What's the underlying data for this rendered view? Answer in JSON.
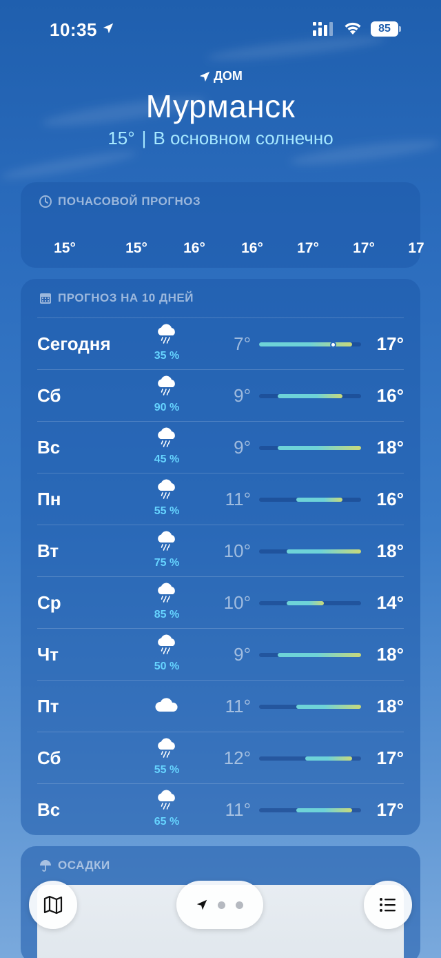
{
  "status_bar": {
    "time": "10:35",
    "battery": "85"
  },
  "header": {
    "home_label": "ДОМ",
    "city": "Мурманск",
    "current_temp": "15°",
    "separator": "|",
    "condition": "В основном солнечно"
  },
  "hourly": {
    "title": "ПОЧАСОВОЙ ПРОГНОЗ",
    "temps": [
      "15°",
      "15°",
      "16°",
      "16°",
      "17°",
      "17°",
      "17"
    ]
  },
  "daily": {
    "title": "ПРОГНОЗ НА 10 ДНЕЙ",
    "range_min": 7,
    "range_max": 18,
    "days": [
      {
        "name": "Сегодня",
        "pop": "35 %",
        "low": "7°",
        "high": "17°",
        "low_val": 7,
        "high_val": 17,
        "icon": "cloud-rain-icon",
        "current_val": 15
      },
      {
        "name": "Сб",
        "pop": "90 %",
        "low": "9°",
        "high": "16°",
        "low_val": 9,
        "high_val": 16,
        "icon": "cloud-rain-icon"
      },
      {
        "name": "Вс",
        "pop": "45 %",
        "low": "9°",
        "high": "18°",
        "low_val": 9,
        "high_val": 18,
        "icon": "cloud-rain-icon"
      },
      {
        "name": "Пн",
        "pop": "55 %",
        "low": "11°",
        "high": "16°",
        "low_val": 11,
        "high_val": 16,
        "icon": "cloud-rain-icon"
      },
      {
        "name": "Вт",
        "pop": "75 %",
        "low": "10°",
        "high": "18°",
        "low_val": 10,
        "high_val": 18,
        "icon": "cloud-rain-icon"
      },
      {
        "name": "Ср",
        "pop": "85 %",
        "low": "10°",
        "high": "14°",
        "low_val": 10,
        "high_val": 14,
        "icon": "cloud-rain-icon"
      },
      {
        "name": "Чт",
        "pop": "50 %",
        "low": "9°",
        "high": "18°",
        "low_val": 9,
        "high_val": 18,
        "icon": "cloud-rain-icon"
      },
      {
        "name": "Пт",
        "pop": "",
        "low": "11°",
        "high": "18°",
        "low_val": 11,
        "high_val": 18,
        "icon": "cloud-icon"
      },
      {
        "name": "Сб",
        "pop": "55 %",
        "low": "12°",
        "high": "17°",
        "low_val": 12,
        "high_val": 17,
        "icon": "cloud-rain-icon"
      },
      {
        "name": "Вс",
        "pop": "65 %",
        "low": "11°",
        "high": "17°",
        "low_val": 11,
        "high_val": 17,
        "icon": "cloud-rain-icon"
      }
    ]
  },
  "precip": {
    "title": "ОСАДКИ"
  },
  "toolbar": {
    "map_icon": "map-icon",
    "location_icon": "location-arrow-icon",
    "list_icon": "list-icon"
  },
  "colors": {
    "accent_text": "#a6e8ff",
    "pop_text": "#66d4ff",
    "bar_cool": "#6ed3d8",
    "bar_warm": "#c9d97a"
  }
}
